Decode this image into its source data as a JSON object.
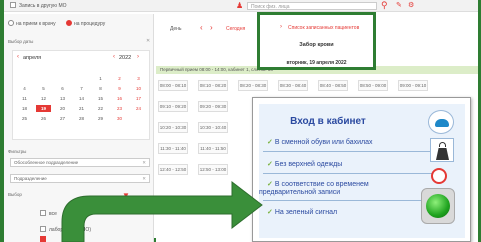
{
  "topbar": {
    "checkbox_label": "Запись в другую МО",
    "search_placeholder": "Поиск физ. лица"
  },
  "left": {
    "radio1": "на прием к врачу",
    "radio2": "на процедуру",
    "date_label": "Выбор даты",
    "month": "апреля",
    "year": "2022",
    "calendar_rows": [
      [
        "",
        "",
        "",
        "",
        "1",
        "2",
        "3"
      ],
      [
        "4",
        "5",
        "6",
        "7",
        "8",
        "9",
        "10"
      ],
      [
        "11",
        "12",
        "13",
        "14",
        "15",
        "16",
        "17"
      ],
      [
        "18",
        "19",
        "20",
        "21",
        "22",
        "23",
        "24"
      ],
      [
        "25",
        "26",
        "27",
        "28",
        "29",
        "30",
        ""
      ]
    ],
    "selected_day": "19",
    "filters_label": "Фильтры",
    "filter1": "Обособленное подразделение",
    "filter2": "Подразделение",
    "choose_label": "Выбор",
    "list_item1": "все",
    "list_item2": "лаборатория (ЛО)"
  },
  "sched": {
    "view": "День",
    "today": "Сегодня",
    "link": "Список записанных пациентов",
    "title": "Забор крови",
    "date": "вторник, 19 апреля 2022",
    "reception_info": "Первичный прием 08:00 - 14:00, кабинет 1, слотов: 36",
    "row1": [
      "08:00 - 08:10",
      "08:10 - 08:20",
      "08:20 - 08:30",
      "08:30 - 08:40",
      "08:40 - 08:50",
      "08:50 - 09:00",
      "09:00 - 09:10"
    ],
    "row2": [
      "09:10 - 09:20",
      "09:20 - 09:30"
    ],
    "row3": [
      "10:20 - 10:30",
      "10:30 - 10:40"
    ],
    "row4": [
      "11:30 - 11:40",
      "11:40 - 11:50"
    ],
    "row5": [
      "12:40 - 12:50",
      "12:50 - 13:00"
    ]
  },
  "poster": {
    "title": "Вход в кабинет",
    "item1": "В сменной обуви или бахилах",
    "item2": "Без верхней одежды",
    "item3a": "В соответствие со временем",
    "item3b": "предварительной записи",
    "item4": "На зеленый сигнал"
  }
}
